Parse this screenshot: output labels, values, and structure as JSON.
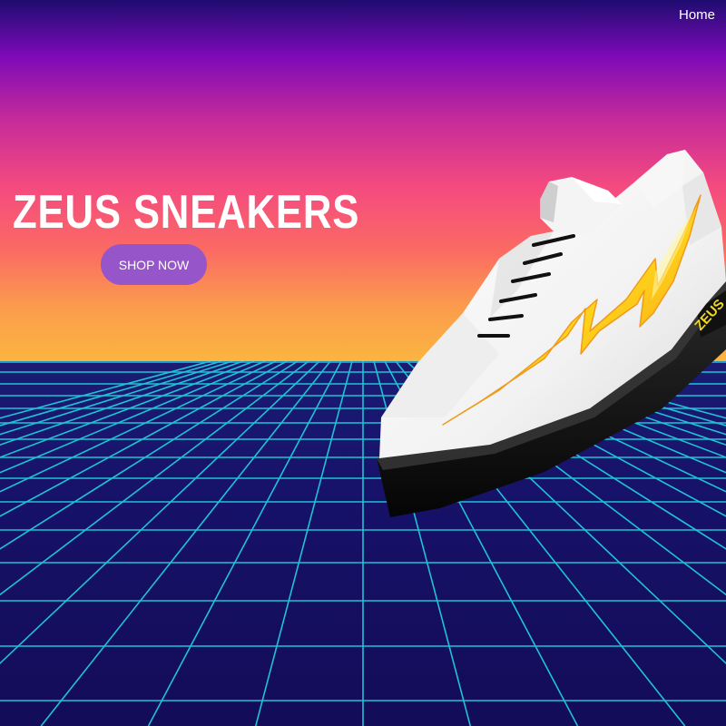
{
  "nav": {
    "home_label": "Home"
  },
  "hero": {
    "title": "ZEUS SNEAKERS",
    "cta_label": "SHOP NOW"
  },
  "sneaker": {
    "brand_text": "ZEUS",
    "sole_color": "#0a0a0a",
    "upper_color": "#ffffff",
    "bolt_colors": [
      "#ffe21a",
      "#f6a21d"
    ]
  },
  "colors": {
    "sky_top": "#1e0c70",
    "sky_purple": "#7d0ab8",
    "sky_pink": "#f44a80",
    "sky_orange": "#fbb540",
    "ground": "#16105a",
    "grid_line": "#1fc3d4",
    "button": "#9656c9"
  }
}
